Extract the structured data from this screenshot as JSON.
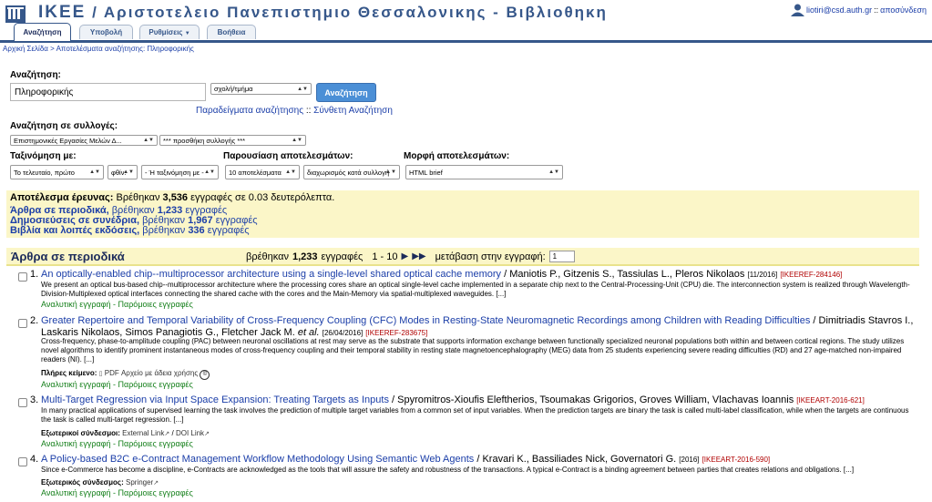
{
  "header": {
    "title_prefix": "ΙΚΕΕ",
    "title_rest": "/ Αριστοτελειο Πανεπιστημιο Θεσσαλονικης - Βιβλιοθηκη",
    "user_email": "liotiri@csd.auth.gr",
    "separator": "::",
    "logout_label": "αποσύνδεση"
  },
  "tabs": [
    "Αναζήτηση",
    "Υποβολή",
    "Ρυθμίσεις",
    "Βοήθεια"
  ],
  "breadcrumb": "Αρχική Σελίδα > Αποτελέσματα αναζήτησης: Πληροφορικής",
  "search": {
    "label": "Αναζήτηση:",
    "query": "Πληροφορικής",
    "field_select": "σχολή/τμήμα",
    "button": "Αναζήτηση",
    "examples_link": "Παραδείγματα αναζήτησης",
    "links_sep": "::",
    "advanced_link": "Σύνθετη Αναζήτηση"
  },
  "collections": {
    "label": "Αναζήτηση σε συλλογές:",
    "select1": "Επιστημονικές Εργασίες Μελών Δ...",
    "select2": "*** προσθήκη συλλογής ***"
  },
  "sort": {
    "label": "Ταξινόμηση με:",
    "select1": "Το τελευταίο, πρώτο",
    "select2": "φθίν.",
    "select3": "- Ή ταξινόμηση με -"
  },
  "display": {
    "label": "Παρουσίαση αποτελεσμάτων:",
    "select1": "10 αποτελέσματα",
    "select2": "διαχωρισμός κατά συλλογή"
  },
  "format": {
    "label": "Μορφή αποτελεσμάτων:",
    "select1": "HTML brief"
  },
  "summary": {
    "line1_label": "Αποτέλεσμα έρευνας:",
    "line1_text1": "Βρέθηκαν",
    "line1_count": "3,536",
    "line1_text2": "εγγραφές σε 0.03 δευτερόλεπτα.",
    "line2_link": "Άρθρα σε περιοδικά,",
    "line2_text1": "βρέθηκαν",
    "line2_count": "1,233",
    "line2_text2": "εγγραφές",
    "line3_link": "Δημοσιεύσεις σε συνέδρια,",
    "line3_text1": "βρέθηκαν",
    "line3_count": "1,967",
    "line3_text2": "εγγραφές",
    "line4_link": "Βιβλία και λοιπές εκδόσεις,",
    "line4_text1": "βρέθηκαν",
    "line4_count": "336",
    "line4_text2": "εγγραφές"
  },
  "section": {
    "title": "Άρθρα σε περιοδικά",
    "found_text1": "βρέθηκαν",
    "found_count": "1,233",
    "found_text2": "εγγραφές",
    "range": "1 - 10",
    "jump_label": "μετάβαση στην εγγραφή:",
    "jump_value": "1"
  },
  "records": [
    {
      "num": "1.",
      "title": "An optically-enabled chip--multiprocessor architecture using a single-level shared optical cache memory",
      "authors": "/ Maniotis P., Gitzenis S., Tassiulas L., Pleros Nikolaos",
      "date": "[11/2016]",
      "id": "[IKEEREF-284146]",
      "abstract": "We present an optical bus-based chip--multiprocessor architecture where the processing cores share an optical single-level cache implemented in a separate chip next to the Central-Processing-Unit (CPU) die. The interconnection system is realized through Wavelength-Division-Multiplexed optical interfaces connecting the shared cache with the cores and the Main-Memory via spatial-multiplexed waveguides. [...]",
      "detailed": "Αναλυτική εγγραφή - Παρόμοιες εγγραφές"
    },
    {
      "num": "2.",
      "title": "Greater Repertoire and Temporal Variability of Cross-Frequency Coupling (CFC) Modes in Resting-State Neuromagnetic Recordings among Children with Reading Difficulties",
      "authors_pre": "/ Dimitriadis Stavros I., Laskaris Nikolaos, Simos Panagiotis G., Fletcher Jack M.",
      "authors_etal": "et al.",
      "date": "[26/04/2016]",
      "id": "[IKEEREF-283675]",
      "abstract": "Cross-frequency, phase-to-amplitude coupling (PAC) between neuronal oscillations at rest may serve as the substrate that supports information exchange between functionally specialized neuronal populations both within and between cortical regions. The study utilizes novel algorithms to identify prominent instantaneous modes of cross-frequency coupling and their temporal stability in resting state magnetoencephalography (MEG) data from 25 students experiencing severe reading difficulties (RD) and 27 age-matched non-impaired readers (NI). [...]",
      "fulltext_label": "Πλήρες κείμενο:",
      "fulltext_value": "PDF Αρχείο με άδεια χρήσης",
      "detailed": "Αναλυτική εγγραφή - Παρόμοιες εγγραφές"
    },
    {
      "num": "3.",
      "title": "Multi-Target Regression via Input Space Expansion: Treating Targets as Inputs",
      "authors": "/ Spyromitros-Xioufis Eleftherios, Tsoumakas Grigorios, Groves William, Vlachavas Ioannis",
      "id": "[IKEEART-2016-621]",
      "abstract": "In many practical applications of supervised learning the task involves the prediction of multiple target variables from a common set of input variables. When the prediction targets are binary the task is called multi-label classification, while when the targets are continuous the task is called multi-target regression. [...]",
      "ext_label": "Εξωτερικοί σύνδεσμοι:",
      "ext_value1": "External Link",
      "ext_sep": "/",
      "ext_value2": "DOI Link",
      "detailed": "Αναλυτική εγγραφή - Παρόμοιες εγγραφές"
    },
    {
      "num": "4.",
      "title": "A Policy-based B2C e-Contract Management Workflow Methodology Using Semantic Web Agents",
      "authors": "/ Kravari K., Bassiliades Nick, Governatori G.",
      "date": "[2016]",
      "id": "[IKEEART-2016-590]",
      "abstract": "Since e-Commerce has become a discipline, e-Contracts are acknowledged as the tools that will assure the safety and robustness of the transactions. A typical e-Contract is a binding agreement between parties that creates relations and obligations. [...]",
      "ext_label": "Εξωτερικός σύνδεσμος:",
      "ext_value1": "Springer",
      "detailed": "Αναλυτική εγγραφή - Παρόμοιες εγγραφές"
    }
  ],
  "colors": {
    "brand": "#36578a",
    "link": "#1b3ea8",
    "green": "#16801c",
    "highlight": "#fbf6c8",
    "button": "#4b8fd6"
  }
}
